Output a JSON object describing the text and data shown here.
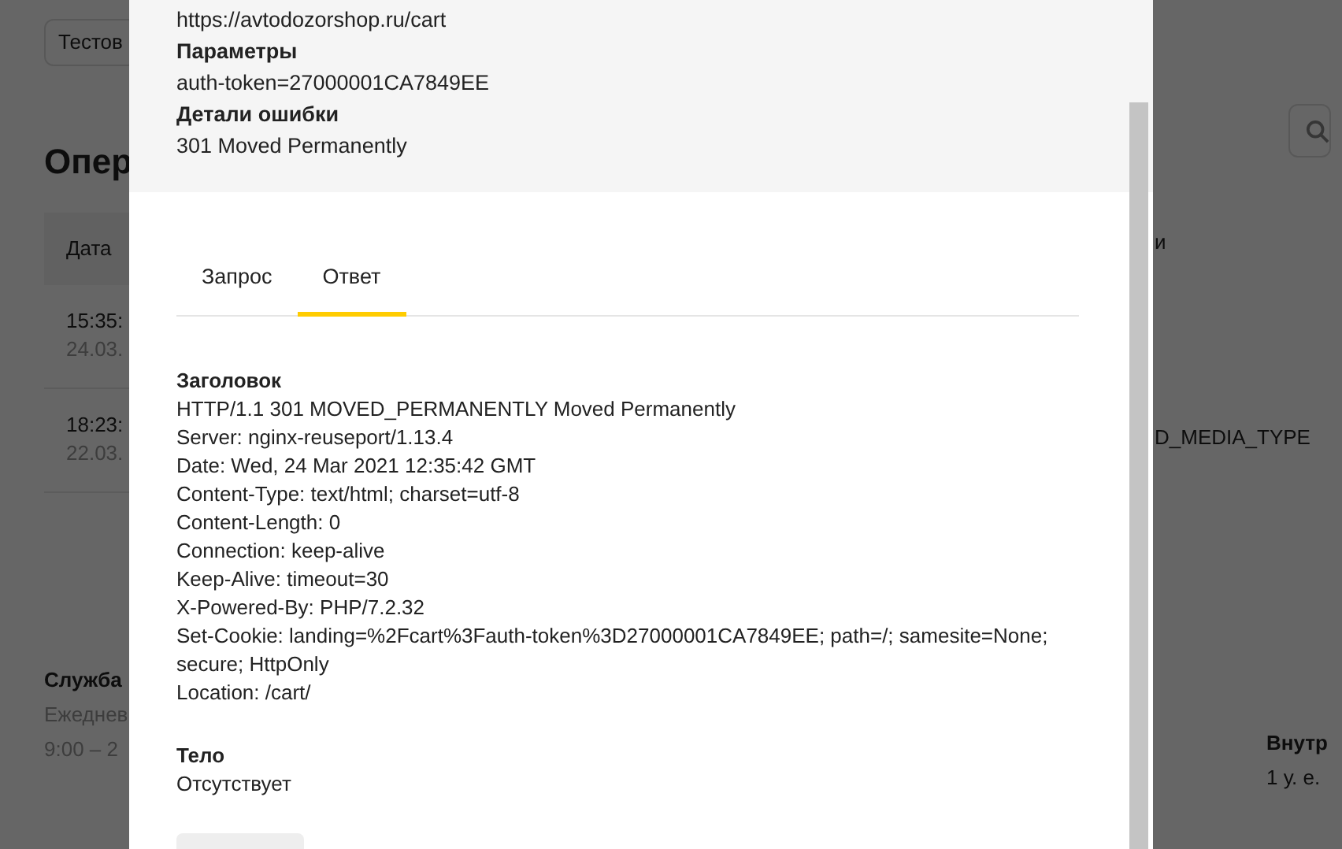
{
  "background": {
    "chip": "Тестов",
    "heading": "Опер",
    "table": {
      "header": "Дата",
      "header_right": "и",
      "rows": [
        {
          "time": "15:35:",
          "date": "24.03."
        },
        {
          "time": "18:23:",
          "date": "22.03.",
          "column_right": "D_MEDIA_TYPE"
        }
      ]
    },
    "footer_left": {
      "title": "Служба",
      "lines": [
        "Ежеднев",
        "9:00 – 2"
      ]
    },
    "footer_right": {
      "title": "Внутр",
      "lines": [
        "1 у. е."
      ]
    }
  },
  "modal": {
    "url": "https://avtodozorshop.ru/cart",
    "sections": [
      {
        "title": "Параметры",
        "value": "auth-token=27000001CA7849EE"
      },
      {
        "title": "Детали ошибки",
        "value": "301 Moved Permanently"
      }
    ],
    "tabs": [
      {
        "label": "Запрос",
        "selected": false
      },
      {
        "label": "Ответ",
        "selected": true
      }
    ],
    "response": {
      "header_title": "Заголовок",
      "header_lines": [
        "HTTP/1.1 301 MOVED_PERMANENTLY Moved Permanently",
        "Server: nginx-reuseport/1.13.4",
        "Date: Wed, 24 Mar 2021 12:35:42 GMT",
        "Content-Type: text/html; charset=utf-8",
        "Content-Length: 0",
        "Connection: keep-alive",
        "Keep-Alive: timeout=30",
        "X-Powered-By: PHP/7.2.32",
        "Set-Cookie: landing=%2Fcart%3Fauth-token%3D27000001CA7849EE; path=/; samesite=None; secure; HttpOnly",
        "Location: /cart/"
      ],
      "body_title": "Тело",
      "body": "Отсутствует"
    }
  }
}
